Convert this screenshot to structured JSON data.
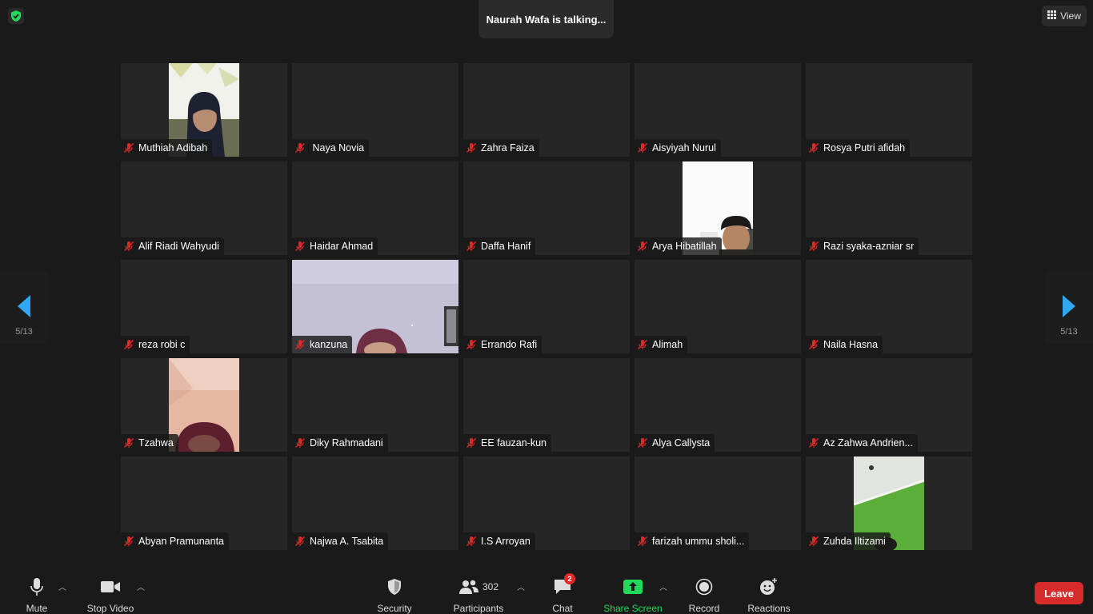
{
  "header": {
    "talking_text": "Naurah Wafa is talking...",
    "view_label": "View"
  },
  "pagination": {
    "left_label": "5/13",
    "right_label": "5/13"
  },
  "participants": [
    {
      "name": "Muthiah Adibah",
      "video": "hijab-girl"
    },
    {
      "name": " Naya Novia",
      "video": null
    },
    {
      "name": "Zahra Faiza",
      "video": null
    },
    {
      "name": "Aisyiyah Nurul",
      "video": null
    },
    {
      "name": "Rosya Putri afidah",
      "video": null
    },
    {
      "name": "Alif Riadi Wahyudi",
      "video": null
    },
    {
      "name": "Haidar Ahmad",
      "video": null
    },
    {
      "name": "Daffa Hanif",
      "video": null
    },
    {
      "name": "Arya Hibatillah",
      "video": "boy"
    },
    {
      "name": "Razi syaka-azniar sr",
      "video": null
    },
    {
      "name": "reza robi c",
      "video": null
    },
    {
      "name": "kanzuna",
      "video": "purple-room"
    },
    {
      "name": "Errando Rafi",
      "video": null
    },
    {
      "name": "Alimah",
      "video": null
    },
    {
      "name": "Naila Hasna",
      "video": null
    },
    {
      "name": "Tzahwa",
      "video": "peach-wall"
    },
    {
      "name": "Diky Rahmadani",
      "video": null
    },
    {
      "name": "EE fauzan-kun",
      "video": null
    },
    {
      "name": "Alya Callysta",
      "video": null
    },
    {
      "name": "Az Zahwa Andrien...",
      "video": null
    },
    {
      "name": "Abyan Pramunanta",
      "video": null
    },
    {
      "name": "Najwa A. Tsabita",
      "video": null
    },
    {
      "name": "I.S Arroyan",
      "video": null
    },
    {
      "name": "farizah ummu sholi...",
      "video": null
    },
    {
      "name": "Zuhda Iltizami",
      "video": "green-ceiling"
    }
  ],
  "toolbar": {
    "mute_label": "Mute",
    "stop_video_label": "Stop Video",
    "security_label": "Security",
    "participants_label": "Participants",
    "participants_count": "302",
    "chat_label": "Chat",
    "chat_badge": "2",
    "share_label": "Share Screen",
    "record_label": "Record",
    "reactions_label": "Reactions",
    "leave_label": "Leave"
  },
  "colors": {
    "share_green": "#23d959",
    "leave_red": "#d72a2a",
    "nav_blue": "#2ea8f0",
    "muted_red": "#e02828"
  }
}
